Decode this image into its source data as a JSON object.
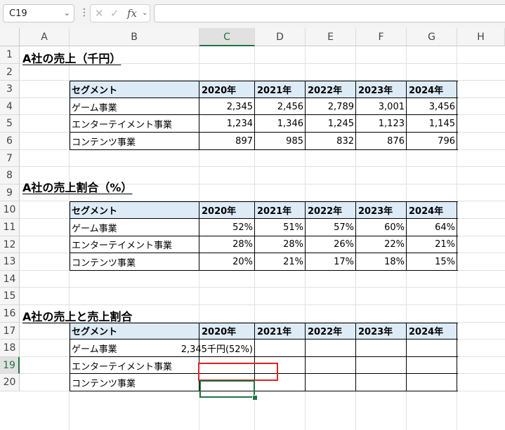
{
  "formula_bar": {
    "name_box": "C19",
    "dots": "⋮",
    "fx_label": "fx",
    "formula": ""
  },
  "columns": [
    "A",
    "B",
    "C",
    "D",
    "E",
    "F",
    "G",
    "H"
  ],
  "selected_column": "C",
  "rows": [
    "1",
    "2",
    "3",
    "4",
    "5",
    "6",
    "7",
    "8",
    "9",
    "10",
    "11",
    "12",
    "13",
    "14",
    "15",
    "16",
    "17",
    "18",
    "19",
    "20"
  ],
  "selected_row": "19",
  "titles": {
    "t1": "A社の売上（千円）",
    "t2": "A社の売上割合（%）",
    "t3": "A社の売上と売上割合"
  },
  "table_headers": [
    "セグメント",
    "2020年",
    "2021年",
    "2022年",
    "2023年",
    "2024年"
  ],
  "table1": {
    "rows": [
      {
        "segment": "ゲーム事業",
        "values": [
          "2,345",
          "2,456",
          "2,789",
          "3,001",
          "3,456"
        ]
      },
      {
        "segment": "エンターテイメント事業",
        "values": [
          "1,234",
          "1,346",
          "1,245",
          "1,123",
          "1,145"
        ]
      },
      {
        "segment": "コンテンツ事業",
        "values": [
          "897",
          "985",
          "832",
          "876",
          "796"
        ]
      }
    ]
  },
  "table2": {
    "rows": [
      {
        "segment": "ゲーム事業",
        "values": [
          "52%",
          "51%",
          "57%",
          "60%",
          "64%"
        ]
      },
      {
        "segment": "エンターテイメント事業",
        "values": [
          "28%",
          "28%",
          "26%",
          "22%",
          "21%"
        ]
      },
      {
        "segment": "コンテンツ事業",
        "values": [
          "20%",
          "21%",
          "17%",
          "18%",
          "15%"
        ]
      }
    ]
  },
  "table3": {
    "rows": [
      {
        "segment": "ゲーム事業",
        "values": [
          "2,345千円(52%)",
          "",
          "",
          "",
          ""
        ]
      },
      {
        "segment": "エンターテイメント事業",
        "values": [
          "",
          "",
          "",
          "",
          ""
        ]
      },
      {
        "segment": "コンテンツ事業",
        "values": [
          "",
          "",
          "",
          "",
          ""
        ]
      }
    ]
  },
  "colors": {
    "header_fill": "#ddebf7",
    "selection": "#217346",
    "highlight": "#e02020"
  }
}
